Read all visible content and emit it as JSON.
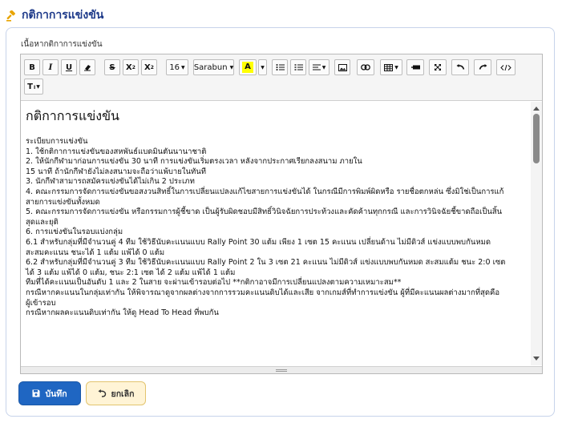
{
  "header": {
    "title": "กติกาการแข่งขัน",
    "icon": "gavel-icon",
    "icon_color": "#e8a400",
    "title_color": "#1e3a8a"
  },
  "form": {
    "field_label": "เนื้อหากติกาการแข่งขัน"
  },
  "toolbar": {
    "font_size": "16",
    "font_family": "Sarabun",
    "highlight_color": "#ffff00",
    "bold": "B",
    "italic": "I",
    "underline": "U",
    "strike": "S",
    "superscript": "X",
    "subscript": "X",
    "text_style": "T"
  },
  "content": {
    "heading": "กติกาการแข่งขัน",
    "lines": [
      "ระเบียบการแข่งขัน",
      "1. ใช้กติกาการแข่งขันของสหพันธ์แบดมินตันนานาชาติ",
      "2. ให้นักกีฬามาก่อนการแข่งขัน 30 นาที การแข่งขันเริ่มตรงเวลา หลังจากประกาศเรียกลงสนาม ภายใน",
      "15 นาที ถ้านักกีฬายังไม่ลงสนามจะถือว่าแพ้บายในทันที",
      "3. นักกีฬาสามารถสมัครแข่งขันได้ไม่เกิน 2 ประเภท",
      "4. คณะกรรมการจัดการแข่งขันขอสงวนสิทธิ์ในการเปลี่ยนแปลงแก้ไขสายการแข่งขันได้ ในกรณีมีการพิมพ์ผิดหรือ รายชื่อตกหล่น ซึ่งมิใช่เป็นการแก้",
      "สายการแข่งขันทั้งหมด",
      "5. คณะกรรมการจัดการแข่งขัน หรือกรรมการผู้ชี้ขาด เป็นผู้รับผิดชอบมีสิทธิ์วินิจฉัยการประท้วงและคัดค้านทุกกรณี และการวินิจฉัยชี้ขาดถือเป็นสิ้น",
      "สุดและยุติ",
      "6. การแข่งขันในรอบแบ่งกลุ่ม",
      "6.1 สำหรับกลุ่มที่มีจำนวนคู่ 4 ทีม ใช้วิธีนับคะแนนแบบ Rally Point 30 แต้ม เพียง 1 เซต 15 คะแนน เปลี่ยนด้าน ไม่มีดิวส์ แข่งแบบพบกันหมด",
      "สะสมคะแนน ชนะได้ 1 แต้ม แพ้ได้ 0 แต้ม",
      "6.2 สำหรับกลุ่มที่มีจำนวนคู่ 3 ทีม ใช้วิธีนับคะแนนแบบ Rally Point 2 ใน 3 เซต 21 คะแนน ไม่มีดิวส์ แข่งแบบพบกันหมด สะสมแต้ม ชนะ 2:0 เซต",
      "ได้ 3 แต้ม แพ้ได้ 0 แต้ม, ชนะ 2:1 เซต ได้ 2 แต้ม แพ้ได้ 1 แต้ม",
      "ทีมที่ได้คะแนนเป็นอันดับ 1 และ 2 ในสาย จะผ่านเข้ารอบต่อไป **กติกาอาจมีการเปลี่ยนแปลงตามความเหมาะสม**",
      "กรณีหากคะแนนในกลุ่มเท่ากัน ให้พิจารณาดูจากผลต่างจากการรวมคะแนนดิบได้และเสีย จากเกมส์ที่ทำการแข่งขัน ผู้ที่มีคะแนนผลต่างมากที่สุดคือ",
      "ผู้เข้ารอบ",
      "กรณีหากผลคะแนนดิบเท่ากัน ให้ดู Head To Head ที่พบกัน"
    ]
  },
  "buttons": {
    "save": "บันทึก",
    "cancel": "ยกเลิก",
    "save_color": "#1f66c2",
    "cancel_color": "#fff4d6"
  }
}
